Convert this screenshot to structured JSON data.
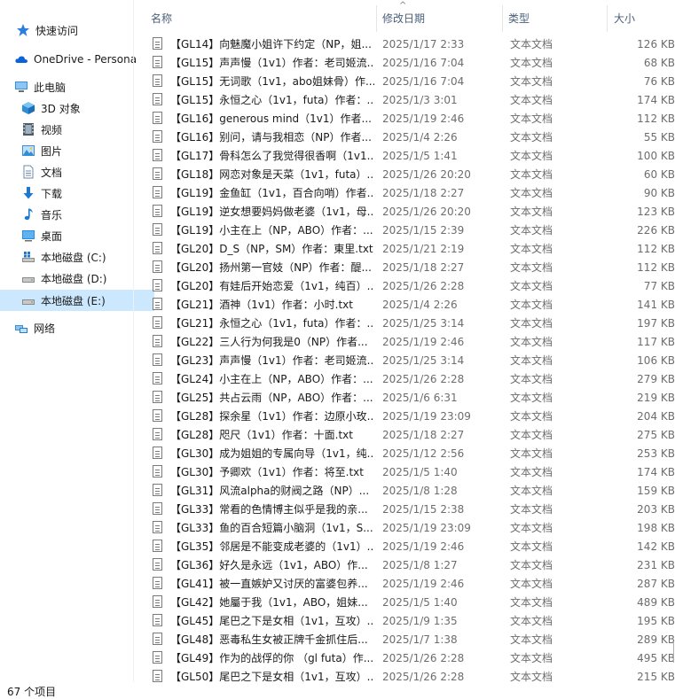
{
  "sidebar": {
    "items": [
      {
        "label": "快速访问",
        "icon": "star-icon",
        "color": "#2b7de0"
      },
      {
        "label": "OneDrive - Persona",
        "icon": "cloud-icon",
        "color": "#0a64d6"
      },
      {
        "label": "此电脑",
        "icon": "computer-icon",
        "color": "#3a8fd9"
      },
      {
        "label": "3D 对象",
        "icon": "cube-icon",
        "color": "#33a0e0"
      },
      {
        "label": "视频",
        "icon": "film-icon",
        "color": "#505a66"
      },
      {
        "label": "图片",
        "icon": "pictures-icon",
        "color": "#3a8fd9"
      },
      {
        "label": "文档",
        "icon": "document-icon",
        "color": "#6e8aa8"
      },
      {
        "label": "下载",
        "icon": "download-icon",
        "color": "#1e78d2"
      },
      {
        "label": "音乐",
        "icon": "music-icon",
        "color": "#1e78d2"
      },
      {
        "label": "桌面",
        "icon": "desktop-icon",
        "color": "#2a8ee0"
      },
      {
        "label": "本地磁盘 (C:)",
        "icon": "windows-drive-icon",
        "color": "#6d6d6d"
      },
      {
        "label": "本地磁盘 (D:)",
        "icon": "drive-icon",
        "color": "#6d6d6d"
      },
      {
        "label": "本地磁盘 (E:)",
        "icon": "drive-icon",
        "color": "#6d6d6d"
      },
      {
        "label": "网络",
        "icon": "network-icon",
        "color": "#3a8fd9"
      }
    ],
    "selected_color": "#cce8ff"
  },
  "header": {
    "name": "名称",
    "date": "修改日期",
    "type": "类型",
    "size": "大小",
    "sort_arrow": "^"
  },
  "files": [
    {
      "name": "【GL14】向魅魔小姐许下约定（NP，姐...",
      "date": "2025/1/17 2:33",
      "type": "文本文档",
      "size": "126 KB"
    },
    {
      "name": "【GL15】声声慢（1v1）作者：老司姬流...",
      "date": "2025/1/16 7:04",
      "type": "文本文档",
      "size": "68 KB"
    },
    {
      "name": "【GL15】无词歌（1v1，abo姐妹骨）作...",
      "date": "2025/1/16 7:04",
      "type": "文本文档",
      "size": "76 KB"
    },
    {
      "name": "【GL15】永恒之心（1v1，futa）作者：...",
      "date": "2025/1/3 3:01",
      "type": "文本文档",
      "size": "174 KB"
    },
    {
      "name": "【GL16】generous mind（1v1）作者...",
      "date": "2025/1/19 2:46",
      "type": "文本文档",
      "size": "112 KB"
    },
    {
      "name": "【GL16】别问，请与我相恋（NP）作者...",
      "date": "2025/1/4 2:26",
      "type": "文本文档",
      "size": "55 KB"
    },
    {
      "name": "【GL17】骨科怎么了我觉得很香啊（1v1...",
      "date": "2025/1/5 1:41",
      "type": "文本文档",
      "size": "100 KB"
    },
    {
      "name": "【GL18】网恋对象是天菜（1v1，futa）...",
      "date": "2025/1/26 20:20",
      "type": "文本文档",
      "size": "60 KB"
    },
    {
      "name": "【GL19】金鱼缸（1v1，百合向哨）作者...",
      "date": "2025/1/18 2:27",
      "type": "文本文档",
      "size": "90 KB"
    },
    {
      "name": "【GL19】逆女想要妈妈做老婆（1v1，母...",
      "date": "2025/1/26 20:20",
      "type": "文本文档",
      "size": "123 KB"
    },
    {
      "name": "【GL19】小主在上（NP，ABO）作者：...",
      "date": "2025/1/15 2:39",
      "type": "文本文档",
      "size": "226 KB"
    },
    {
      "name": "【GL20】D_S（NP，SM）作者：東里.txt",
      "date": "2025/1/21 2:19",
      "type": "文本文档",
      "size": "112 KB"
    },
    {
      "name": "【GL20】扬州第一官妓（NP）作者：醍...",
      "date": "2025/1/18 2:27",
      "type": "文本文档",
      "size": "112 KB"
    },
    {
      "name": "【GL20】有娃后开始恋爱（1v1，纯百）...",
      "date": "2025/1/26 2:28",
      "type": "文本文档",
      "size": "77 KB"
    },
    {
      "name": "【GL21】酒神（1v1）作者：小时.txt",
      "date": "2025/1/4 2:26",
      "type": "文本文档",
      "size": "141 KB"
    },
    {
      "name": "【GL21】永恒之心（1v1，futa）作者：...",
      "date": "2025/1/25 3:14",
      "type": "文本文档",
      "size": "197 KB"
    },
    {
      "name": "【GL22】三人行为何我是0（NP）作者...",
      "date": "2025/1/19 2:46",
      "type": "文本文档",
      "size": "117 KB"
    },
    {
      "name": "【GL23】声声慢（1v1）作者：老司姬流...",
      "date": "2025/1/25 3:14",
      "type": "文本文档",
      "size": "106 KB"
    },
    {
      "name": "【GL24】小主在上（NP，ABO）作者：...",
      "date": "2025/1/26 2:28",
      "type": "文本文档",
      "size": "279 KB"
    },
    {
      "name": "【GL25】共占云雨（NP，ABO）作者：...",
      "date": "2025/1/6 6:31",
      "type": "文本文档",
      "size": "219 KB"
    },
    {
      "name": "【GL28】探余星（1v1）作者：边原小玫...",
      "date": "2025/1/19 23:09",
      "type": "文本文档",
      "size": "204 KB"
    },
    {
      "name": "【GL28】咫尺（1v1）作者：十面.txt",
      "date": "2025/1/18 2:27",
      "type": "文本文档",
      "size": "275 KB"
    },
    {
      "name": "【GL30】成为姐姐的专属向导（1v1，纯...",
      "date": "2025/1/12 2:56",
      "type": "文本文档",
      "size": "253 KB"
    },
    {
      "name": "【GL30】予卿欢（1v1）作者：将至.txt",
      "date": "2025/1/5 1:40",
      "type": "文本文档",
      "size": "174 KB"
    },
    {
      "name": "【GL31】风流alpha的财阀之路（NP）...",
      "date": "2025/1/8 1:28",
      "type": "文本文档",
      "size": "159 KB"
    },
    {
      "name": "【GL33】常看的色情博主似乎是我的亲...",
      "date": "2025/1/15 2:38",
      "type": "文本文档",
      "size": "203 KB"
    },
    {
      "name": "【GL33】鱼的百合短篇小脑洞（1v1，S...",
      "date": "2025/1/19 23:09",
      "type": "文本文档",
      "size": "198 KB"
    },
    {
      "name": "【GL35】邻居是不能变成老婆的（1v1）...",
      "date": "2025/1/19 2:46",
      "type": "文本文档",
      "size": "142 KB"
    },
    {
      "name": "【GL36】好久是永远（1v1，ABO）作...",
      "date": "2025/1/8 1:27",
      "type": "文本文档",
      "size": "231 KB"
    },
    {
      "name": "【GL41】被一直嫉妒又讨厌的富婆包养...",
      "date": "2025/1/19 2:46",
      "type": "文本文档",
      "size": "287 KB"
    },
    {
      "name": "【GL42】她屬于我（1v1，ABO，姐妹...",
      "date": "2025/1/5 1:40",
      "type": "文本文档",
      "size": "489 KB"
    },
    {
      "name": "【GL45】尾巴之下是女相（1v1，互攻）...",
      "date": "2025/1/9 1:35",
      "type": "文本文档",
      "size": "195 KB"
    },
    {
      "name": "【GL48】恶毒私生女被正牌千金抓住后...",
      "date": "2025/1/7 1:38",
      "type": "文本文档",
      "size": "289 KB"
    },
    {
      "name": "【GL49】作为的战俘的你 （gl futa）作...",
      "date": "2025/1/26 2:28",
      "type": "文本文档",
      "size": "495 KB"
    },
    {
      "name": "【GL50】尾巴之下是女相（1v1，互攻）...",
      "date": "2025/1/26 2:28",
      "type": "文本文档",
      "size": "215 KB"
    }
  ],
  "status_bar": {
    "count": "67 个项目"
  }
}
